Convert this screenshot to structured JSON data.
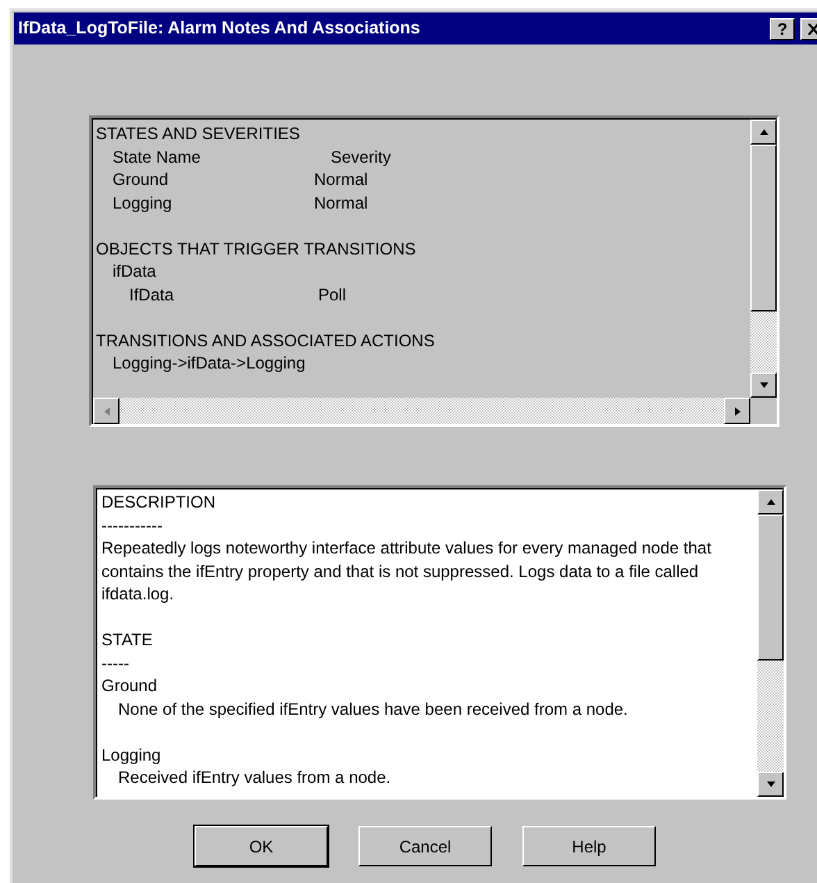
{
  "window": {
    "title": "IfData_LogToFile: Alarm Notes And Associations",
    "help_button": "?"
  },
  "associations": {
    "sections": [
      {
        "kind": "table",
        "heading": "STATES AND SEVERITIES",
        "columns": [
          "State Name",
          "Severity"
        ],
        "rows": [
          [
            "Ground",
            "Normal"
          ],
          [
            "Logging",
            "Normal"
          ]
        ]
      },
      {
        "kind": "tree",
        "heading": "OBJECTS THAT TRIGGER TRANSITIONS",
        "items": [
          {
            "label": "ifData",
            "children": [
              {
                "label": "IfData",
                "value": "Poll"
              }
            ]
          }
        ]
      },
      {
        "kind": "list",
        "heading": "TRANSITIONS AND ASSOCIATED ACTIONS",
        "items": [
          "Logging->ifData->Logging"
        ]
      }
    ]
  },
  "notes": {
    "blocks": [
      {
        "kind": "heading",
        "text": "DESCRIPTION"
      },
      {
        "kind": "rule",
        "text": "-----------"
      },
      {
        "kind": "paragraph",
        "text": "Repeatedly logs noteworthy interface attribute values for every managed node that contains the ifEntry property and that is not suppressed. Logs data to a file called ifdata.log."
      },
      {
        "kind": "gap"
      },
      {
        "kind": "heading",
        "text": "STATE"
      },
      {
        "kind": "rule",
        "text": "-----"
      },
      {
        "kind": "term",
        "text": "Ground"
      },
      {
        "kind": "detail",
        "text": "None of the specified ifEntry values have been received from a node."
      },
      {
        "kind": "gap"
      },
      {
        "kind": "term",
        "text": "Logging"
      },
      {
        "kind": "detail",
        "text": "Received ifEntry values from a node."
      }
    ]
  },
  "buttons": [
    "OK",
    "Cancel",
    "Help"
  ]
}
